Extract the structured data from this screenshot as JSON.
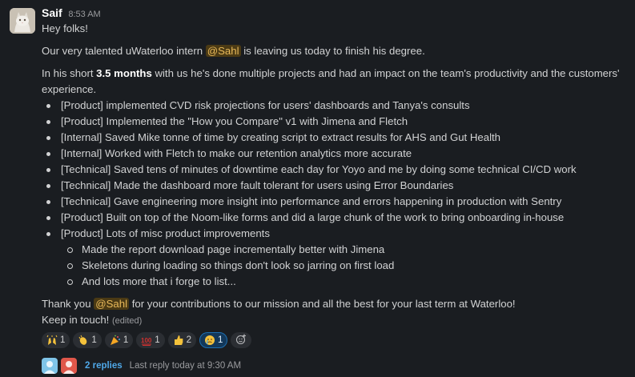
{
  "message": {
    "sender": "Saif",
    "time": "8:53 AM",
    "greeting": "Hey folks!",
    "intro_before": "Our very talented uWaterloo intern ",
    "mention": "@Sahl",
    "intro_after": " is leaving us today to finish his degree.",
    "summary_before": "In his short ",
    "summary_bold": "3.5 months",
    "summary_after": " with us he's done multiple projects and had an impact on the team's productivity and the customers'",
    "summary_wrap": "experience.",
    "bullets": [
      "[Product] implemented CVD risk projections for users' dashboards and Tanya's consults",
      "[Product] Implemented the \"How you Compare\" v1 with Jimena and Fletch",
      "[Internal] Saved Mike tonne of time by creating script to extract results for AHS and Gut Health",
      "[Internal] Worked with Fletch to make our retention analytics more accurate",
      "[Technical] Saved tens of minutes of downtime each day for Yoyo and me by doing some technical CI/CD work",
      "[Technical] Made the dashboard more fault tolerant for users using Error Boundaries",
      "[Technical] Gave engineering more insight into performance and errors happening in production with Sentry",
      "[Product] Built on top of the Noom-like forms and did a large chunk of the work to bring onboarding in-house",
      "[Product] Lots of misc product improvements"
    ],
    "sub_bullets": [
      "Made the report download page incrementally better with Jimena",
      "Skeletons during loading so things don't look so jarring on first load",
      "And lots more that i forge to list..."
    ],
    "thanks_before": "Thank you ",
    "thanks_mention": "@Sahl",
    "thanks_after": " for your contributions to our mission and all the best for your last term at Waterloo!",
    "closing": "Keep in touch!",
    "edited": "(edited)"
  },
  "reactions": [
    {
      "emoji": "raised-hands",
      "count": "1",
      "mine": false
    },
    {
      "emoji": "clapping-hands",
      "count": "1",
      "mine": false
    },
    {
      "emoji": "party-popper",
      "count": "1",
      "mine": false
    },
    {
      "emoji": "hundred-points",
      "count": "1",
      "mine": false
    },
    {
      "emoji": "thumbs-up",
      "count": "2",
      "mine": false
    },
    {
      "emoji": "crying-face",
      "count": "1",
      "mine": true
    }
  ],
  "thread": {
    "replies": "2 replies",
    "last_reply": "Last reply today at 9:30 AM"
  },
  "colors": {
    "background": "#1a1d21",
    "text": "#d1d2d3",
    "mention_bg": "#4b3a14",
    "mention_text": "#e8b95a",
    "link": "#4fa8e8",
    "own_reaction": "#13385a"
  }
}
